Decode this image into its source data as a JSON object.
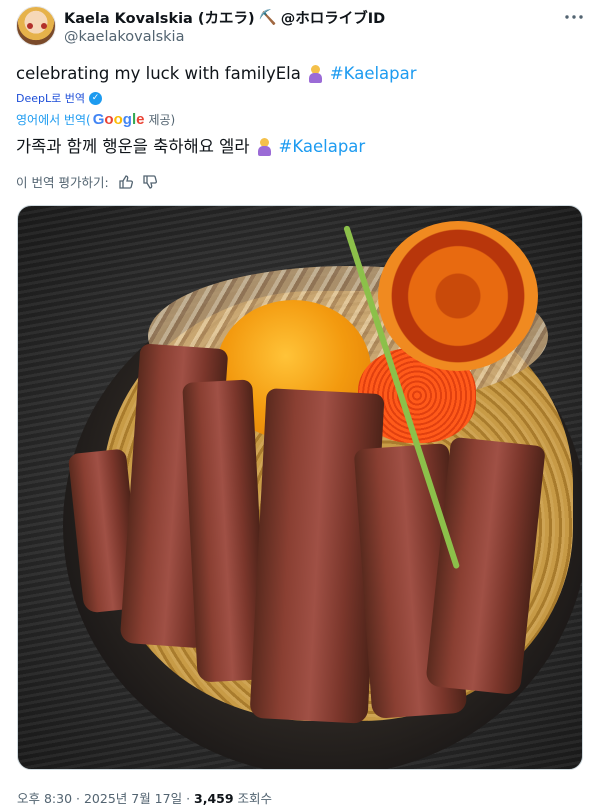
{
  "author": {
    "display_name": "Kaela Kovalskia (カエラ)",
    "name_emoji": "⛏️",
    "affiliation": "@ホロライブID",
    "handle": "@kaelakovalskia"
  },
  "tweet": {
    "text": "celebrating my luck with familyEla",
    "hashtag": "#Kaelapar"
  },
  "translation": {
    "deepl_label": "DeepL로 번역",
    "google_prefix": "영어에서 번역(",
    "google_brand": [
      "G",
      "o",
      "o",
      "g",
      "l",
      "e"
    ],
    "google_suffix": "제공)",
    "translated_text": "가족과 함께 행운을 축하해요 엘라",
    "hashtag": "#Kaelapar",
    "rate_label": "이 번역 평가하기:"
  },
  "meta": {
    "time": "오후 8:30",
    "date": "2025년 7월 17일",
    "views": "3,459",
    "views_label": "조회수"
  },
  "icons": {
    "more": "more-icon",
    "thumb_up": "thumb-up-icon",
    "thumb_down": "thumb-down-icon",
    "verified": "deepl-check-icon"
  },
  "colors": {
    "link": "#1d9bf0",
    "secondary": "#536471",
    "text": "#0f1419"
  }
}
